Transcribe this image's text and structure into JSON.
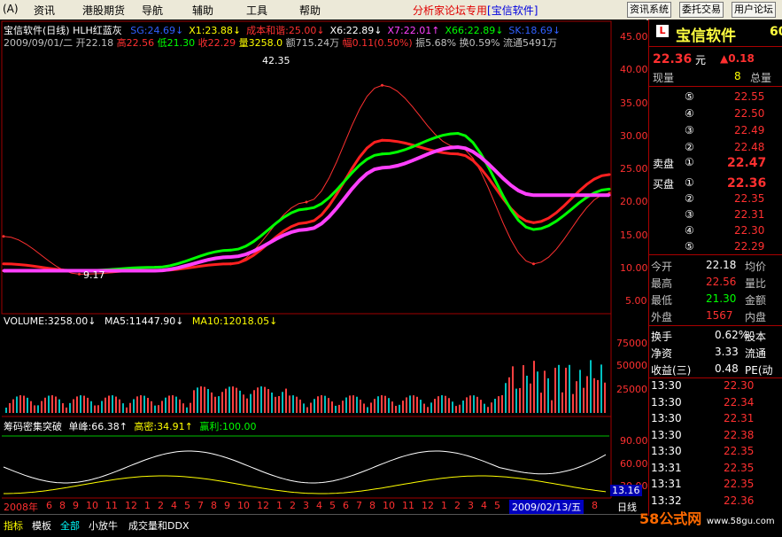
{
  "menu": {
    "items": [
      "资讯",
      "港股期货",
      "导航",
      "辅助",
      "工具",
      "帮助"
    ],
    "brand": "分析家论坛专用",
    "brand_app": "[宝信软件]",
    "buttons": [
      "资讯系统",
      "委托交易",
      "用户论坛"
    ]
  },
  "chart": {
    "title_line": "宝信软件(日线) HLH红蓝灰",
    "indicators": [
      {
        "text": "SG:24.69↓",
        "color": "#3060ff"
      },
      {
        "text": "X1:23.88↓",
        "color": "#ffff00"
      },
      {
        "text": "成本和谐:25.00↓",
        "color": "#ff3030"
      },
      {
        "text": "X6:22.89↓",
        "color": "#ffffff"
      },
      {
        "text": "X7:22.01↑",
        "color": "#ff40ff"
      },
      {
        "text": "X66:22.89↓",
        "color": "#00ff00"
      },
      {
        "text": "SK:18.69↓",
        "color": "#3060ff"
      }
    ],
    "ohlc_line": {
      "date": "2009/09/01/二",
      "open": "开22.18",
      "high": "高22.56",
      "low": "低21.30",
      "close": "收22.29",
      "vol": "量3258.0",
      "amt": "额715.24万",
      "chg": "幅0.11(0.50%)",
      "amp": "振5.68%",
      "turn": "换0.59%",
      "float": "流通5491万"
    },
    "high_mark": "42.35",
    "low_mark": "9.17",
    "price_axis": [
      "45.00",
      "40.00",
      "35.00",
      "30.00",
      "25.00",
      "20.00",
      "15.00",
      "10.00",
      "5.00"
    ],
    "volume_line": {
      "volume": "VOLUME:3258.00↓",
      "ma5": "MA5:11447.90↓",
      "ma10": "MA10:12018.05↓"
    },
    "volume_axis": [
      "75000",
      "50000",
      "25000"
    ],
    "chip_line": {
      "name": "筹码密集突破",
      "peak": "单峰:66.38↑",
      "dense": "高密:34.91↑",
      "profit": "赢利:100.00"
    },
    "chip_axis": [
      "90.00",
      "60.00",
      "30.00"
    ],
    "chip_current": "13.16",
    "date_axis": {
      "year": "2008年",
      "months": [
        "6",
        "8",
        "9",
        "10",
        "11",
        "12",
        "1",
        "2",
        "4",
        "5",
        "7",
        "8",
        "9",
        "10",
        "12",
        "1",
        "2",
        "3",
        "4",
        "5",
        "6",
        "7",
        "8",
        "10",
        "11",
        "12",
        "1",
        "2",
        "3",
        "4",
        "5",
        "6",
        "7",
        "8"
      ],
      "cursor": "2009/02/13/五",
      "tail": "8",
      "unit": "日线"
    }
  },
  "chart_data": {
    "type": "line",
    "title": "宝信软件(日线)",
    "xlabel": "",
    "ylabel": "",
    "ylim": [
      5,
      45
    ],
    "x": [
      "2008-06",
      "2008-08",
      "2008-10",
      "2008-12",
      "2009-02",
      "2009-04",
      "2009-06",
      "2009-08",
      "2009-09"
    ],
    "series": [
      {
        "name": "",
        "values": [
          16,
          10.5,
          11,
          12,
          21,
          38,
          29,
          12,
          22.29
        ]
      },
      {
        "name": "成本和谐",
        "values": [
          12,
          11,
          11,
          12,
          18,
          30,
          28,
          18,
          25.0
        ]
      },
      {
        "name": "X66",
        "values": [
          11,
          11,
          11.5,
          14,
          20,
          28,
          31,
          17,
          22.89
        ]
      },
      {
        "name": "X7",
        "values": [
          11,
          11,
          11,
          13,
          17,
          26,
          29,
          22,
          22.01
        ]
      }
    ],
    "grid": false,
    "legend": "top-left"
  },
  "quote": {
    "name": "宝信软件",
    "code_tail": "60",
    "price": "22.36",
    "price_unit": "元",
    "change": "▲0.18",
    "rows1": [
      {
        "l": "现量",
        "v": "8",
        "r": "总量"
      }
    ],
    "sell": [
      {
        "n": "⑤",
        "v": "22.55"
      },
      {
        "n": "④",
        "v": "22.50"
      },
      {
        "n": "③",
        "v": "22.49"
      },
      {
        "n": "②",
        "v": "22.48"
      }
    ],
    "sell1": {
      "l": "卖盘",
      "n": "①",
      "v": "22.47"
    },
    "buy1": {
      "l": "买盘",
      "n": "①",
      "v": "22.36"
    },
    "buy": [
      {
        "n": "②",
        "v": "22.35"
      },
      {
        "n": "③",
        "v": "22.31"
      },
      {
        "n": "④",
        "v": "22.30"
      },
      {
        "n": "⑤",
        "v": "22.29"
      }
    ],
    "stats": [
      {
        "l": "今开",
        "v": "22.18",
        "r": "均价",
        "c": "white"
      },
      {
        "l": "最高",
        "v": "22.56",
        "r": "量比",
        "c": "red"
      },
      {
        "l": "最低",
        "v": "21.30",
        "r": "金额",
        "c": "green"
      },
      {
        "l": "外盘",
        "v": "1567",
        "r": "内盘",
        "c": "red"
      }
    ],
    "stats2": [
      {
        "l": "换手",
        "v": "0.62%",
        "r": "股本"
      },
      {
        "l": "净资",
        "v": "3.33",
        "r": "流通"
      },
      {
        "l": "收益(三)",
        "v": "0.48",
        "r": "PE(动"
      }
    ],
    "ticks": [
      {
        "t": "13:30",
        "p": "22.30"
      },
      {
        "t": "13:30",
        "p": "22.34"
      },
      {
        "t": "13:30",
        "p": "22.31"
      },
      {
        "t": "13:30",
        "p": "22.38"
      },
      {
        "t": "13:30",
        "p": "22.35"
      },
      {
        "t": "13:31",
        "p": "22.35"
      },
      {
        "t": "13:31",
        "p": "22.35"
      },
      {
        "t": "13:32",
        "p": "22.36"
      }
    ]
  },
  "tabs": [
    "指标",
    "模板",
    "全部",
    "小放牛",
    "成交量和DDX"
  ],
  "watermark": {
    "main": "58公式网",
    "url": "www.58gu.com"
  }
}
